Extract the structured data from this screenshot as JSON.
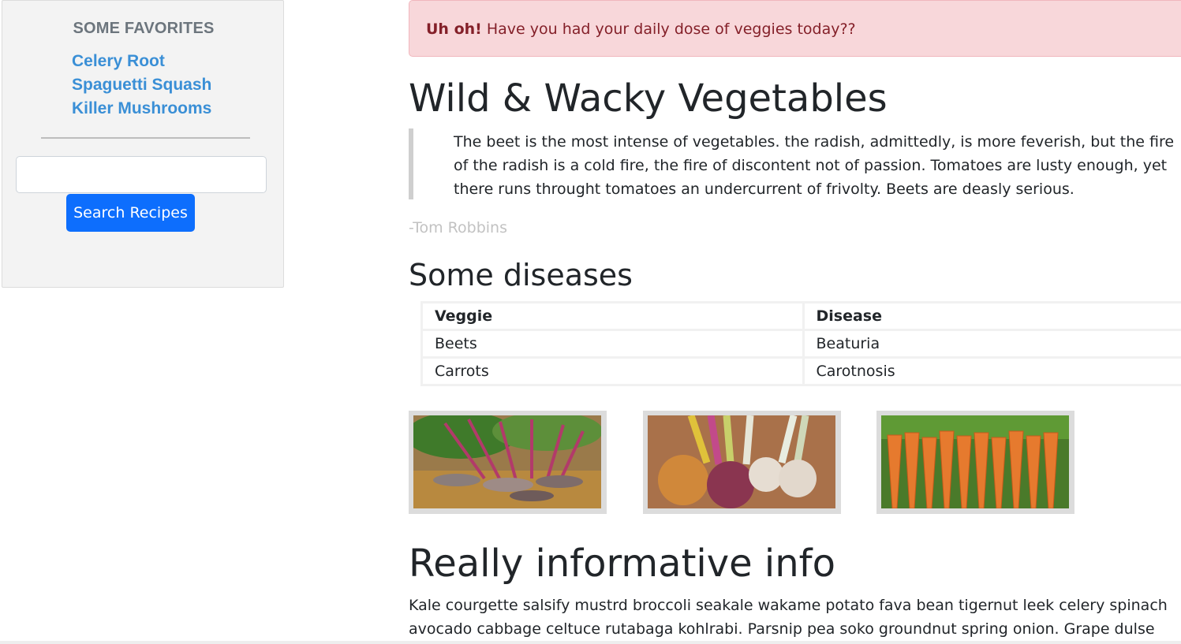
{
  "sidebar": {
    "heading": "SOME FAVORITES",
    "favorites": [
      "Celery Root",
      "Spaguetti Squash",
      "Killer Mushrooms"
    ],
    "search": {
      "value": "",
      "button_label": "Search Recipes"
    }
  },
  "alert": {
    "strong": "Uh oh!",
    "text": " Have you had your daily dose of veggies today??"
  },
  "main": {
    "title": "Wild & Wacky Vegetables",
    "quote": "The beet is the most intense of vegetables. the radish, admittedly, is more feverish, but the fire of the radish is a cold fire, the fire of discontent not of passion. Tomatoes are lusty enough, yet there runs throught tomatoes an undercurrent of frivolty. Beets are deasly serious.",
    "quote_author": "-Tom Robbins",
    "diseases_heading": "Some diseases",
    "table": {
      "headers": [
        "Veggie",
        "Disease"
      ],
      "rows": [
        [
          "Beets",
          "Beaturia"
        ],
        [
          "Carrots",
          "Carotnosis"
        ]
      ]
    },
    "images": [
      "beets-photo",
      "root-vegetables-photo",
      "carrots-photo"
    ],
    "info_heading": "Really informative info",
    "info_text": "Kale courgette salsify mustrd broccoli seakale wakame potato fava bean tigernut leek celery spinach avocado cabbage celtuce rutabaga kohlrabi. Parsnip pea soko groundnut spring onion. Grape dulse rutabaga lentil gram"
  },
  "colors": {
    "link": "#3a8fd6",
    "button": "#0d6efd",
    "alert_bg": "#f8d7da",
    "alert_text": "#842029"
  }
}
